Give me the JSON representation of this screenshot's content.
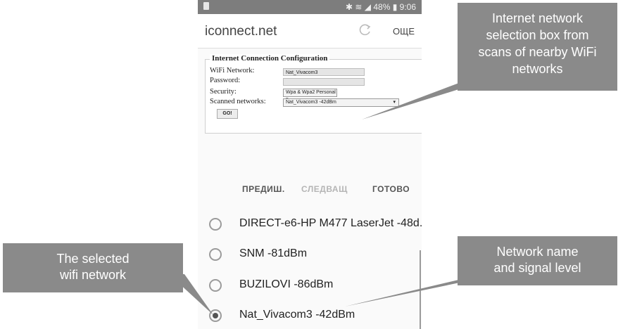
{
  "status_bar": {
    "indicators": "✱ ≋ ◢ 48% ▮ 9:06"
  },
  "browser": {
    "url": "iconnect.net",
    "menu_label": "ОЩЕ"
  },
  "config": {
    "title": "Internet Connection Configuration",
    "wifi_label": "WiFi Network:",
    "wifi_value": "Nat_Vivacom3",
    "password_label": "Password:",
    "password_value": "",
    "security_label": "Security:",
    "security_value": "Wpa & Wpa2 Personal",
    "scanned_label": "Scanned networks:",
    "scanned_value": "Nat_Vivacom3 -42dBm",
    "go_label": "GO!"
  },
  "picker_nav": {
    "prev": "ПРЕДИШ.",
    "next": "СЛЕДВАЩ",
    "done": "ГОТОВО"
  },
  "networks": [
    {
      "label": "DIRECT-e6-HP M477 LaserJet -48d..",
      "selected": false
    },
    {
      "label": "SNM -81dBm",
      "selected": false
    },
    {
      "label": "BUZILOVI -86dBm",
      "selected": false
    },
    {
      "label": "Nat_Vivacom3 -42dBm",
      "selected": true
    }
  ],
  "callouts": {
    "selection_box": [
      "Internet network",
      "selection box from",
      "scans of nearby WiFi",
      "networks"
    ],
    "selected_network": [
      "The selected",
      "wifi network"
    ],
    "name_signal": [
      "Network name",
      "and signal level"
    ]
  },
  "colors": {
    "callout_bg": "#8a8a8a",
    "status_bar": "#7d7d7d",
    "nav_active": "#555555",
    "nav_disabled": "#b5b5b5"
  }
}
